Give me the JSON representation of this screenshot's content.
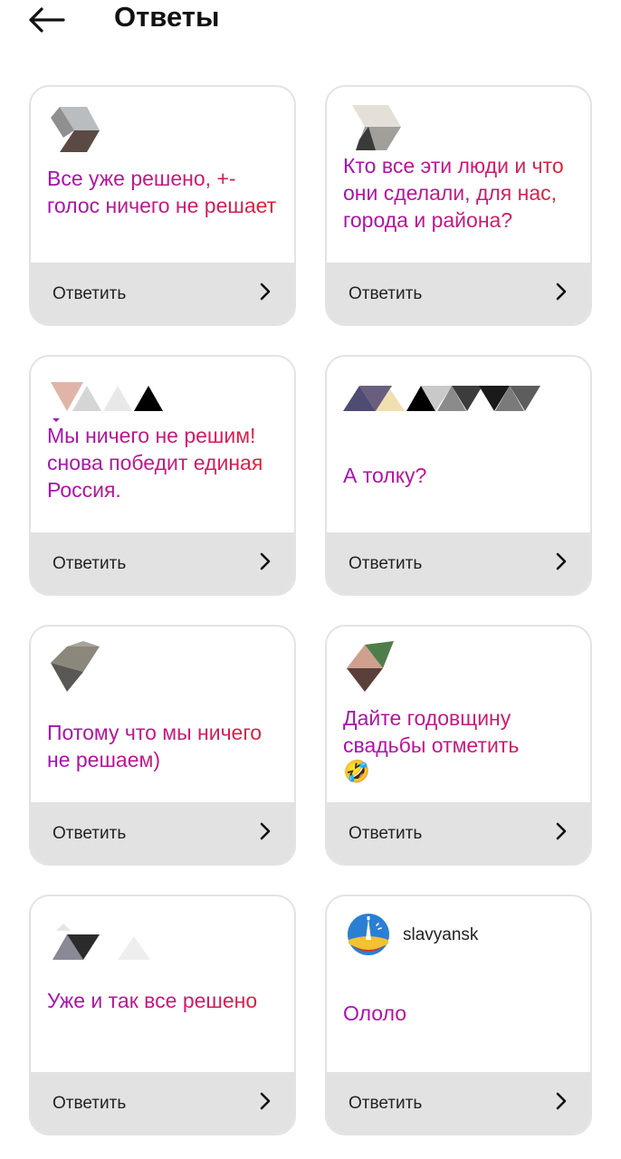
{
  "header": {
    "title": "Ответы",
    "back_icon": "arrow-left-icon"
  },
  "cards": [
    {
      "text": "Все уже решено, +- голос ничего не решает",
      "reply_label": "Ответить"
    },
    {
      "text": "Кто все эти люди и что они сделали, для нас, города и района?",
      "reply_label": "Ответить"
    },
    {
      "text": "Мы ничего не решим!снова победит единая Россия.",
      "reply_label": "Ответить"
    },
    {
      "text": "А толку?",
      "reply_label": "Ответить"
    },
    {
      "text": "Потому что мы ничего не решаем)",
      "reply_label": "Ответить"
    },
    {
      "text": "Дайте годовщину свадьбы отметить",
      "emoji": "🤣",
      "reply_label": "Ответить"
    },
    {
      "text": "Уже и так все решено",
      "reply_label": "Ответить"
    },
    {
      "text": "Ололо",
      "username": "slavyansk",
      "reply_label": "Ответить"
    }
  ],
  "colors": {
    "text_gradient": [
      "#a311b4",
      "#c81a7a",
      "#e0242c"
    ],
    "footer_bg": "#e2e2e2",
    "card_border": "#e3e3e3"
  }
}
